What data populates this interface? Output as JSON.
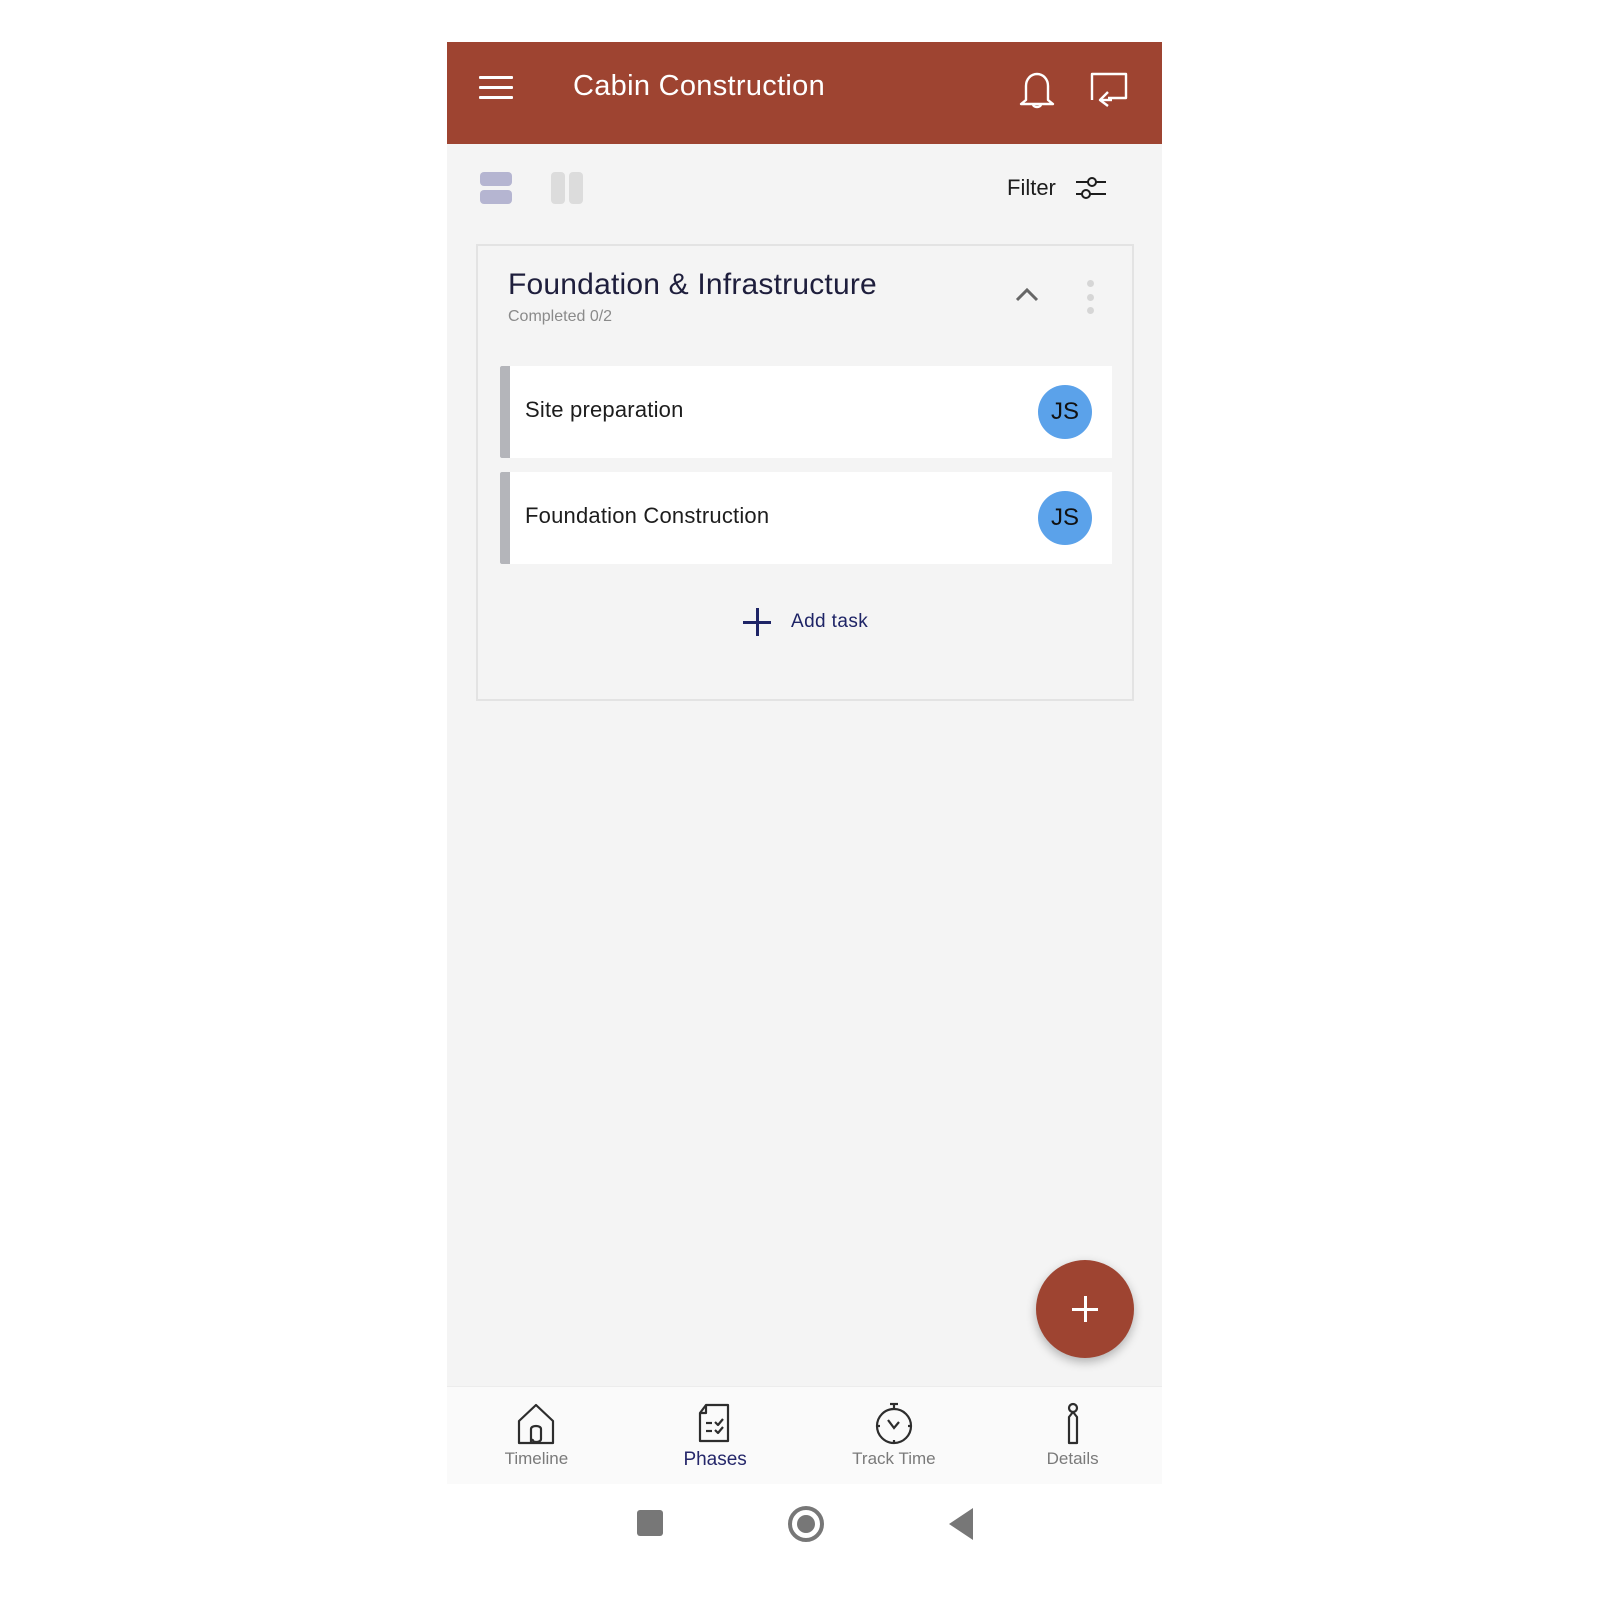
{
  "appbar": {
    "title": "Cabin Construction",
    "icons": [
      "menu-icon",
      "bell-icon",
      "cast-icon"
    ],
    "color": "#9e4431"
  },
  "toolbar": {
    "view_modes": [
      "list-view",
      "board-view"
    ],
    "active_view": "list-view",
    "filter_label": "Filter"
  },
  "phase": {
    "title": "Foundation & Infrastructure",
    "completed": "Completed 0/2",
    "tasks": [
      {
        "name": "Site preparation",
        "assignee_initials": "JS"
      },
      {
        "name": "Foundation Construction",
        "assignee_initials": "JS"
      }
    ],
    "add_task_label": "Add task"
  },
  "fab": {
    "icon": "plus-icon"
  },
  "bottom_nav": {
    "items": [
      {
        "label": "Timeline",
        "icon": "house-icon",
        "active": false
      },
      {
        "label": "Phases",
        "icon": "checklist-document-icon",
        "active": true
      },
      {
        "label": "Track Time",
        "icon": "stopwatch-icon",
        "active": false
      },
      {
        "label": "Details",
        "icon": "info-icon",
        "active": false
      }
    ]
  },
  "system_nav": [
    "recents",
    "home",
    "back"
  ],
  "colors": {
    "accent": "#9e4431",
    "avatar": "#5ba2ea",
    "active_nav": "#25276a"
  }
}
